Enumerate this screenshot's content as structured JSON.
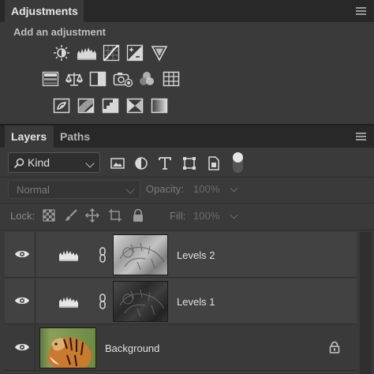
{
  "adjustments_panel": {
    "tab_label": "Adjustments",
    "section_title": "Add an adjustment",
    "icons_row1": [
      "brightness-contrast-icon",
      "levels-icon",
      "curves-icon",
      "exposure-icon",
      "vibrance-icon"
    ],
    "icons_row2": [
      "hue-saturation-icon",
      "color-balance-icon",
      "black-white-icon",
      "photo-filter-icon",
      "channel-mixer-icon",
      "color-lookup-icon"
    ],
    "icons_row3": [
      "invert-icon",
      "posterize-icon",
      "threshold-icon",
      "selective-color-icon",
      "gradient-map-icon"
    ]
  },
  "layers_panel": {
    "tabs": [
      {
        "label": "Layers"
      },
      {
        "label": "Paths"
      }
    ],
    "filter_kind": "Kind",
    "blend_mode": "Normal",
    "opacity_label": "Opacity:",
    "opacity_value": "100%",
    "lock_label": "Lock:",
    "fill_label": "Fill:",
    "fill_value": "100%",
    "layers": [
      {
        "name": "Levels 2",
        "type": "adjustment"
      },
      {
        "name": "Levels 1",
        "type": "adjustment"
      },
      {
        "name": "Background",
        "type": "image",
        "locked": true
      }
    ]
  },
  "colors": {
    "panel": "#3a3a3a",
    "tabbar": "#282828",
    "selected_row": "#424242",
    "text": "#c8c8c8"
  }
}
